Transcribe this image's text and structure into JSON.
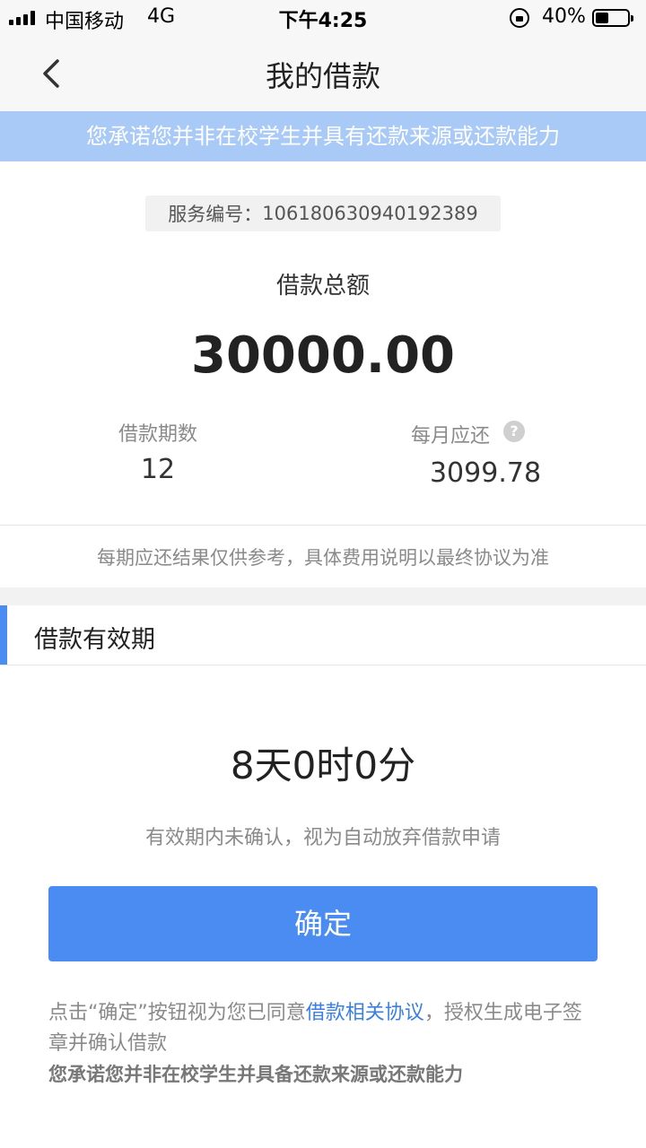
{
  "status_bar": {
    "carrier": "中国移动",
    "network": "4G",
    "time": "下午4:25",
    "battery_percent": "40%",
    "icons": [
      "signal-icon",
      "lock-rotation-icon",
      "battery-icon"
    ]
  },
  "nav": {
    "title": "我的借款",
    "back_icon": "chevron-left-icon"
  },
  "banner": {
    "text": "您承诺您并非在校学生并具有还款来源或还款能力"
  },
  "loan": {
    "service_no_label": "服务编号：",
    "service_no": "1061806309401923​89",
    "total_label": "借款总额",
    "total_amount": "30000.00",
    "term_label": "借款期数",
    "term_value": "12",
    "monthly_label": "每月应还",
    "monthly_value": "3099.78",
    "help_icon": "question-circle-icon",
    "reference_note": "每期应还结果仅供参考，具体费用说明以最终协议为准"
  },
  "validity": {
    "section_title": "借款有效期",
    "countdown": "8天0时0分",
    "note": "有效期内未确认，视为自动放弃借款申请"
  },
  "actions": {
    "confirm_label": "确定"
  },
  "footer": {
    "agreement_prefix": "点击“确定”按钮视为您已同意",
    "agreement_link": "借款相关协议",
    "agreement_suffix": "，授权生成电子签章并确认借款",
    "commitment": "您承诺您并非在校学生并具备还款来源或还款能力"
  },
  "colors": {
    "accent": "#4b8cf2",
    "banner": "#a9caf7",
    "link": "#3a7fe8"
  }
}
